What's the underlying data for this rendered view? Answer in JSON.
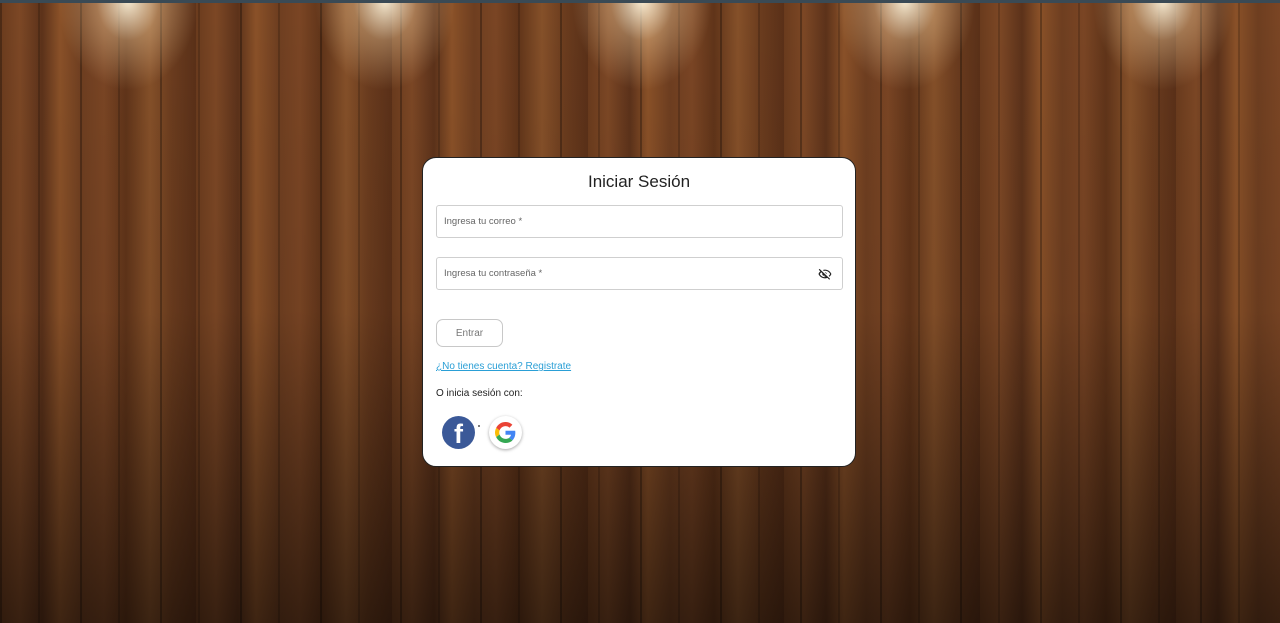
{
  "page": {
    "title": "Iniciar Sesión"
  },
  "form": {
    "email_placeholder": "Ingresa tu correo *",
    "email_value": "",
    "password_placeholder": "Ingresa tu contraseña *",
    "password_value": "",
    "submit_label": "Entrar",
    "register_link": "¿No tienes cuenta? Registrate",
    "social_prompt": "O inicia sesión con:"
  },
  "social": {
    "facebook_glyph": "f",
    "facebook_icon": "facebook-icon",
    "google_icon": "google-icon"
  },
  "colors": {
    "facebook": "#3b5998",
    "link": "#2a9fd6"
  }
}
